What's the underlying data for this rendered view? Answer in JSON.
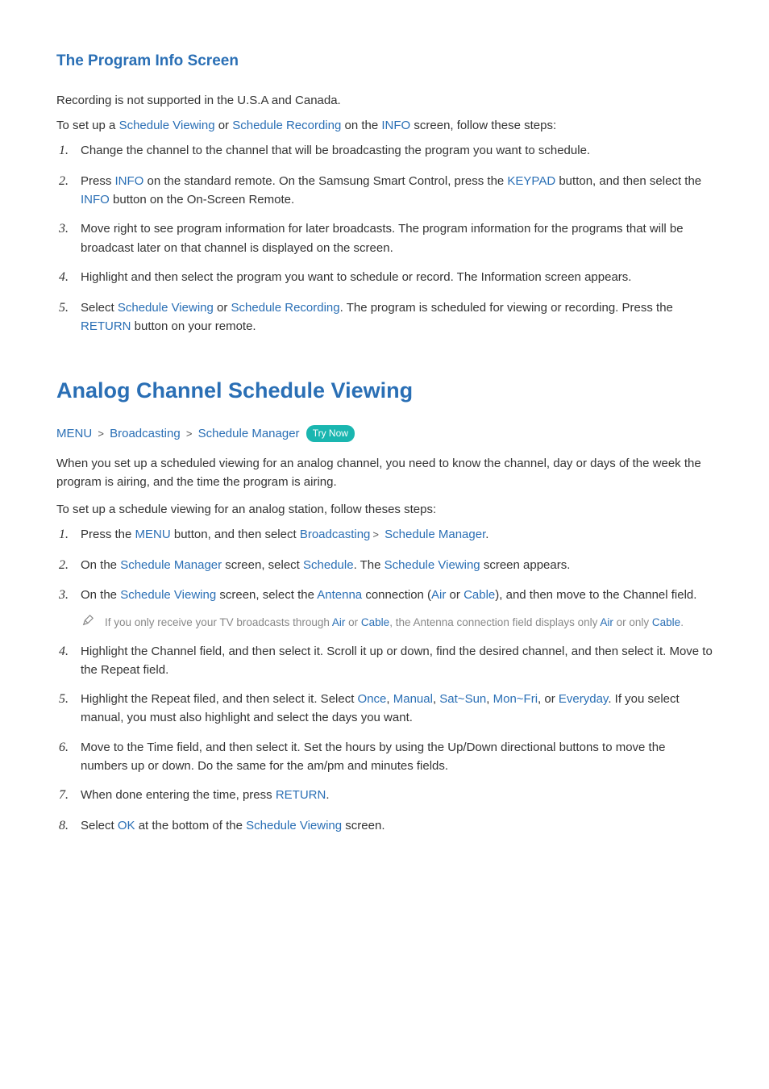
{
  "section1": {
    "title": "The Program Info Screen",
    "p1": "Recording is not supported in the U.S.A and Canada.",
    "p2_pre": "To set up a ",
    "p2_sv": "Schedule Viewing",
    "p2_mid": " or ",
    "p2_sr": "Schedule Recording",
    "p2_mid2": " on the ",
    "p2_info": "INFO",
    "p2_post": " screen, follow these steps:",
    "steps": [
      {
        "n": "1.",
        "body": "Change the channel to the channel that will be broadcasting the program you want to schedule."
      },
      {
        "n": "2.",
        "t1": "Press ",
        "kw1": "INFO",
        "t2": " on the standard remote. On the Samsung Smart Control, press the ",
        "kw2": "KEYPAD",
        "t3": " button, and then select the ",
        "kw3": "INFO",
        "t4": " button on the On-Screen Remote."
      },
      {
        "n": "3.",
        "body": "Move right to see program information for later broadcasts. The program information for the programs that will be broadcast later on that channel is displayed on the screen."
      },
      {
        "n": "4.",
        "body": "Highlight and then select the program you want to schedule or record. The Information screen appears."
      },
      {
        "n": "5.",
        "t1": "Select ",
        "kw1": "Schedule Viewing",
        "t2": " or ",
        "kw2": "Schedule Recording",
        "t3": ". The program is scheduled for viewing or recording. Press the ",
        "kw3": "RETURN",
        "t4": " button on your remote."
      }
    ]
  },
  "section2": {
    "title": "Analog Channel Schedule Viewing",
    "crumb": {
      "menu": "MENU",
      "broadcasting": "Broadcasting",
      "sm": "Schedule Manager",
      "trynow": "Try Now"
    },
    "p1": "When you set up a scheduled viewing for an analog channel, you need to know the channel, day or days of the week the program is airing, and the time the program is airing.",
    "p2": "To set up a schedule viewing for an analog station, follow theses steps:",
    "steps": [
      {
        "n": "1.",
        "t1": "Press the ",
        "kw1": "MENU",
        "t2": " button, and then select ",
        "kw2": "Broadcasting",
        "sep": " > ",
        "kw3": "Schedule Manager",
        "t3": "."
      },
      {
        "n": "2.",
        "t1": "On the ",
        "kw1": "Schedule Manager",
        "t2": " screen, select ",
        "kw2": "Schedule",
        "t3": ". The ",
        "kw3": "Schedule Viewing",
        "t4": " screen appears."
      },
      {
        "n": "3.",
        "t1": "On the ",
        "kw1": "Schedule Viewing",
        "t2": " screen, select the ",
        "kw2": "Antenna",
        "t3": " connection (",
        "kw3": "Air",
        "t4": " or ",
        "kw4": "Cable",
        "t5": "), and then move to the Channel field.",
        "note": {
          "t1": "If you only receive your TV broadcasts through ",
          "kw1": "Air",
          "t2": " or ",
          "kw2": "Cable",
          "t3": ", the Antenna connection field displays only ",
          "kw3": "Air",
          "t4": " or only ",
          "kw4": "Cable",
          "t5": "."
        }
      },
      {
        "n": "4.",
        "body": "Highlight the Channel field, and then select it. Scroll it up or down, find the desired channel, and then select it. Move to the Repeat field."
      },
      {
        "n": "5.",
        "t1": "Highlight the Repeat filed, and then select it. Select ",
        "kw1": "Once",
        "c1": ", ",
        "kw2": "Manual",
        "c2": ", ",
        "kw3": "Sat~Sun",
        "c3": ", ",
        "kw4": "Mon~Fri",
        "c4": ", or ",
        "kw5": "Everyday",
        "t2": ". If you select manual, you must also highlight and select the days you want."
      },
      {
        "n": "6.",
        "body": "Move to the Time field, and then select it. Set the hours by using the Up/Down directional buttons to move the numbers up or down. Do the same for the am/pm and minutes fields."
      },
      {
        "n": "7.",
        "t1": "When done entering the time, press ",
        "kw1": "RETURN",
        "t2": "."
      },
      {
        "n": "8.",
        "t1": "Select ",
        "kw1": "OK",
        "t2": " at the bottom of the ",
        "kw2": "Schedule Viewing",
        "t3": " screen."
      }
    ]
  }
}
